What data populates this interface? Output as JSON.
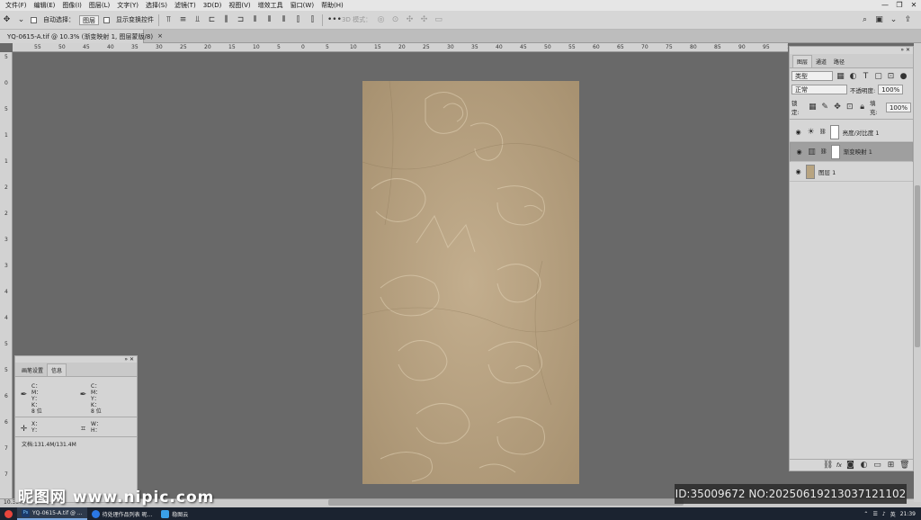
{
  "menubar": {
    "items": [
      "文件(F)",
      "编辑(E)",
      "图像(I)",
      "图层(L)",
      "文字(Y)",
      "选择(S)",
      "滤镜(T)",
      "3D(D)",
      "视图(V)",
      "增效工具",
      "窗口(W)",
      "帮助(H)"
    ],
    "window_controls": [
      "—",
      "❐",
      "✕"
    ]
  },
  "options": {
    "auto_select_label": "自动选择：",
    "auto_select_value": "图层",
    "show_transform_label": "显示变换控件",
    "mode_3d_label": "3D 模式："
  },
  "document_tab": {
    "title": "YQ-0615-A.tif @ 10.3% (渐变映射 1, 图层蒙版/8)",
    "close": "×"
  },
  "rulers": {
    "h_ticks": [
      "55",
      "50",
      "45",
      "40",
      "35",
      "30",
      "25",
      "20",
      "15",
      "10",
      "5",
      "0",
      "5",
      "10",
      "15",
      "20",
      "25",
      "30",
      "35",
      "40",
      "45",
      "50",
      "55",
      "60",
      "65",
      "70",
      "75",
      "80",
      "85",
      "90",
      "95",
      "100"
    ],
    "v_ticks": [
      "5",
      "0",
      "5",
      "1",
      "1",
      "2",
      "2",
      "3",
      "3",
      "4",
      "4",
      "5",
      "5",
      "6",
      "6",
      "7",
      "7"
    ]
  },
  "layers_panel": {
    "tabs": [
      "图层",
      "通道",
      "路径"
    ],
    "filter_label": "类型",
    "blend_mode": "正常",
    "opacity_label": "不透明度:",
    "opacity_value": "100%",
    "lock_label": "锁定:",
    "fill_label": "填充:",
    "fill_value": "100%",
    "layers": [
      {
        "name": "亮度/对比度 1",
        "kind": "adjustment",
        "selected": false
      },
      {
        "name": "渐变映射 1",
        "kind": "gradient-map",
        "selected": true
      },
      {
        "name": "图层 1",
        "kind": "pixel",
        "selected": false
      }
    ],
    "footer_icons": [
      "link-icon",
      "fx-icon",
      "mask-icon",
      "adjustment-icon",
      "group-icon",
      "new-layer-icon",
      "trash-icon"
    ],
    "fx_label": "fx"
  },
  "info_panel": {
    "tabs": [
      "画笔设置",
      "信息"
    ],
    "color_labels_1": [
      "C：",
      "M：",
      "Y：",
      "K："
    ],
    "color_labels_2": [
      "C：",
      "M：",
      "Y：",
      "K："
    ],
    "bit_label": "8 位",
    "xy_labels": [
      "X：",
      "Y："
    ],
    "wh_labels": [
      "W：",
      "H："
    ],
    "doc_size": "文档:131.4M/131.4M"
  },
  "status": {
    "zoom": "10.35%"
  },
  "watermark": {
    "left_text": "昵图网 www.nipic.com",
    "right_text": "ID:35009672 NO:20250619213037121102"
  },
  "taskbar": {
    "items": [
      {
        "label": "",
        "icon": "chrome-icon",
        "color": "#e8453c"
      },
      {
        "label": "YQ-0615-A.tif @ ...",
        "icon": "photoshop-icon",
        "color": "#1b3a6b"
      },
      {
        "label": "待处理作品列表 昵...",
        "icon": "browser-icon",
        "color": "#2b78e4"
      },
      {
        "label": "稳图云",
        "icon": "cloud-icon",
        "color": "#3aa0e8"
      }
    ],
    "tray_lang": "英",
    "tray_time": "21:39"
  }
}
